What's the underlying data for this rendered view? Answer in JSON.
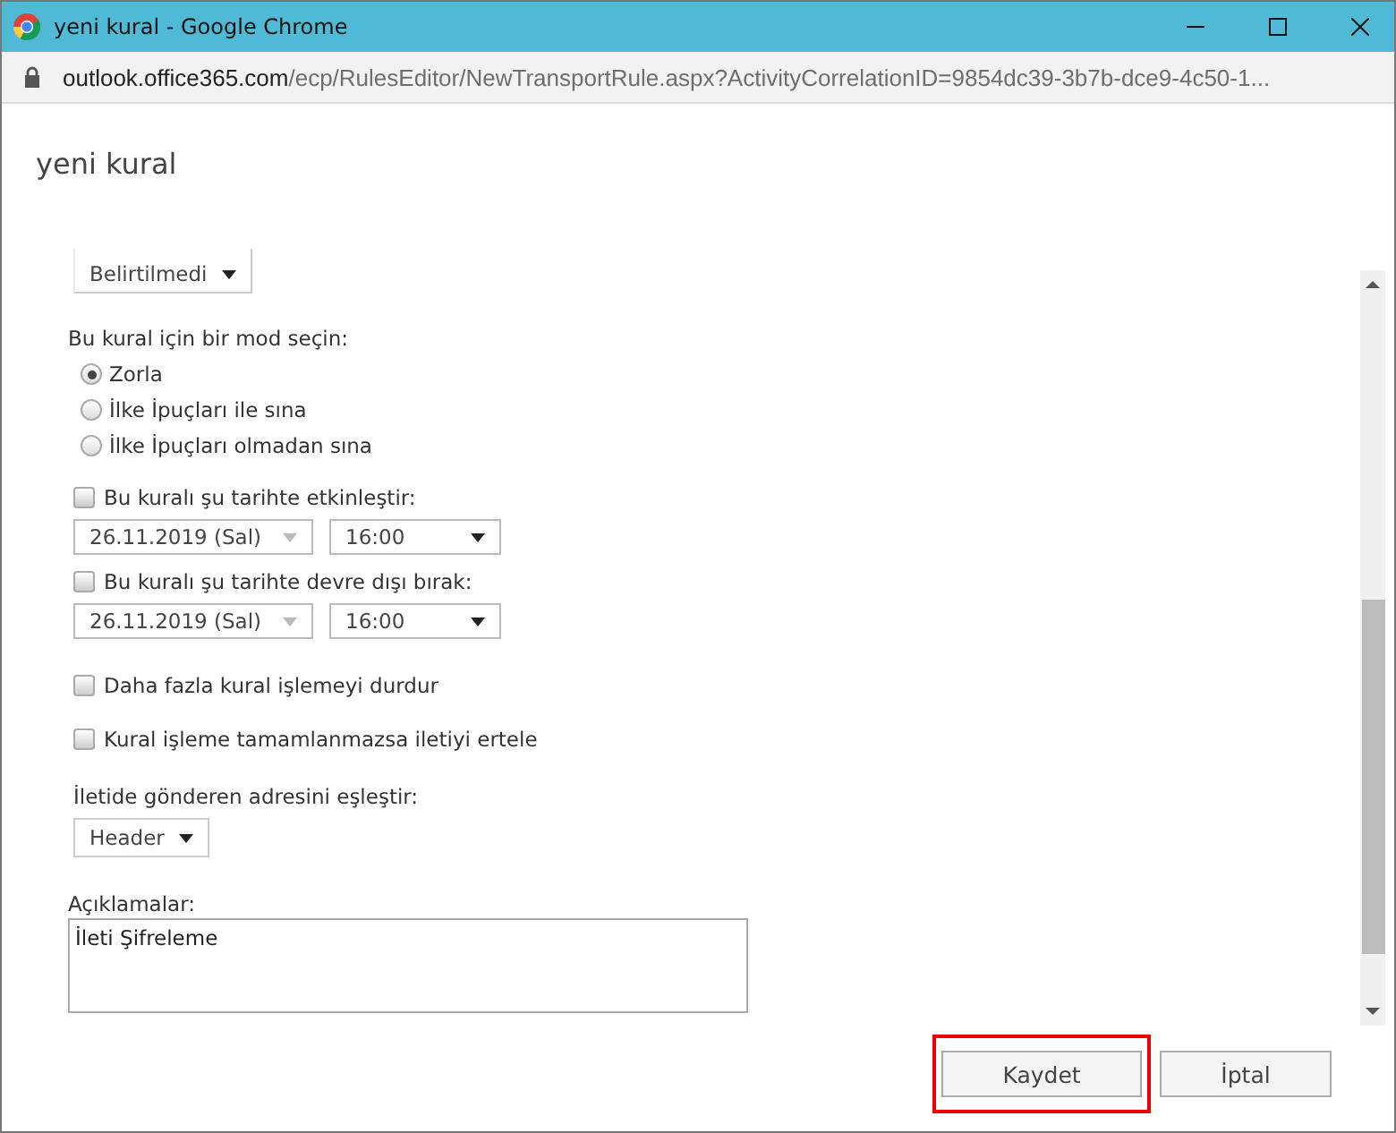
{
  "window": {
    "title": "yeni kural - Google Chrome"
  },
  "address_bar": {
    "host": "outlook.office365.com",
    "path": "/ecp/RulesEditor/NewTransportRule.aspx?ActivityCorrelationID=9854dc39-3b7b-dce9-4c50-1..."
  },
  "heading": "yeni kural",
  "form": {
    "severity_dropdown": {
      "value": "Belirtilmedi"
    },
    "mode_label": "Bu kural için bir mod seçin:",
    "modes": [
      {
        "label": "Zorla",
        "selected": true
      },
      {
        "label": "İlke İpuçları ile sına",
        "selected": false
      },
      {
        "label": "İlke İpuçları olmadan sına",
        "selected": false
      }
    ],
    "schedules": [
      {
        "label": "Bu kuralı şu tarihte etkinleştir:",
        "checked": false,
        "date": "26.11.2019 (Sal)",
        "time": "16:00"
      },
      {
        "label": "Bu kuralı şu tarihte devre dışı bırak:",
        "checked": false,
        "date": "26.11.2019 (Sal)",
        "time": "16:00"
      }
    ],
    "options": [
      {
        "label": "Daha fazla kural işlemeyi durdur",
        "checked": false
      },
      {
        "label": "Kural işleme tamamlanmazsa iletiyi ertele",
        "checked": false
      }
    ],
    "sender_label": "İletide gönderen adresini eşleştir:",
    "sender_dropdown": {
      "value": "Header"
    },
    "comments_label": "Açıklamalar:",
    "comments": "İleti Şifreleme"
  },
  "buttons": [
    {
      "label": "Kaydet",
      "highlighted": true
    },
    {
      "label": "İptal",
      "highlighted": false
    }
  ]
}
